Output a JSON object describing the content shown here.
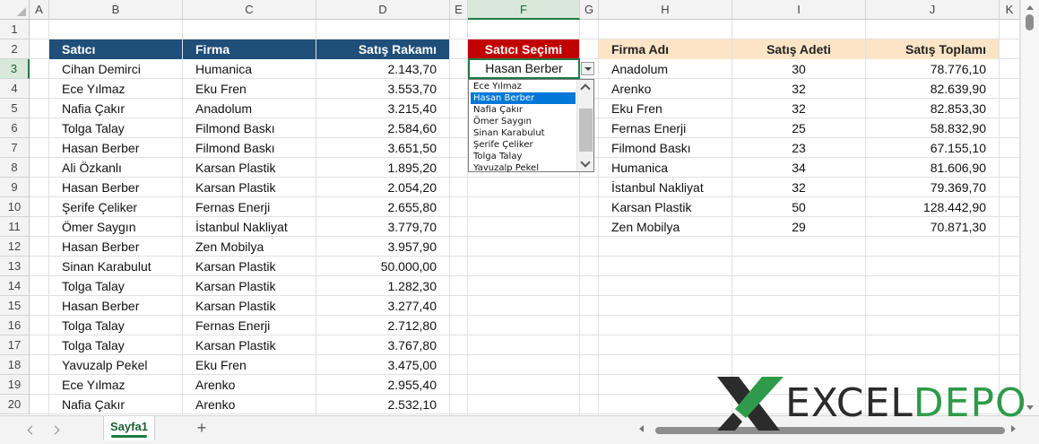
{
  "columns": [
    "A",
    "B",
    "C",
    "D",
    "E",
    "F",
    "G",
    "H",
    "I",
    "J",
    "K"
  ],
  "selected_column": "F",
  "rows": [
    "1",
    "2",
    "3",
    "4",
    "5",
    "6",
    "7",
    "8",
    "9",
    "10",
    "11",
    "12",
    "13",
    "14",
    "15",
    "16",
    "17",
    "18",
    "19",
    "20"
  ],
  "selected_row": "3",
  "sales_table": {
    "headers": [
      "Satıcı",
      "Firma",
      "Satış Rakamı"
    ],
    "rows": [
      [
        "Cihan Demirci",
        "Humanica",
        "2.143,70"
      ],
      [
        "Ece Yılmaz",
        "Eku Fren",
        "3.553,70"
      ],
      [
        "Nafia Çakır",
        "Anadolum",
        "3.215,40"
      ],
      [
        "Tolga Talay",
        "Filmond Baskı",
        "2.584,60"
      ],
      [
        "Hasan Berber",
        "Filmond Baskı",
        "3.651,50"
      ],
      [
        "Ali Özkanlı",
        "Karsan Plastik",
        "1.895,20"
      ],
      [
        "Hasan Berber",
        "Karsan Plastik",
        "2.054,20"
      ],
      [
        "Şerife Çeliker",
        "Fernas Enerji",
        "2.655,80"
      ],
      [
        "Ömer Saygın",
        "İstanbul Nakliyat",
        "3.779,70"
      ],
      [
        "Hasan Berber",
        "Zen Mobilya",
        "3.957,90"
      ],
      [
        "Sinan Karabulut",
        "Karsan Plastik",
        "50.000,00"
      ],
      [
        "Tolga Talay",
        "Karsan Plastik",
        "1.282,30"
      ],
      [
        "Hasan Berber",
        "Karsan Plastik",
        "3.277,40"
      ],
      [
        "Tolga Talay",
        "Fernas Enerji",
        "2.712,80"
      ],
      [
        "Tolga Talay",
        "Karsan Plastik",
        "3.767,80"
      ],
      [
        "Yavuzalp Pekel",
        "Eku Fren",
        "3.475,00"
      ],
      [
        "Ece Yılmaz",
        "Arenko",
        "2.955,40"
      ],
      [
        "Nafia Çakır",
        "Arenko",
        "2.532,10"
      ]
    ]
  },
  "selector": {
    "header": "Satıcı Seçimi",
    "value": "Hasan Berber",
    "dropdown_items": [
      "Ece Yılmaz",
      "Hasan Berber",
      "Nafia Çakır",
      "Ömer Saygın",
      "Sinan Karabulut",
      "Şerife Çeliker",
      "Tolga Talay",
      "Yavuzalp Pekel"
    ],
    "active_item": "Hasan Berber"
  },
  "summary_table": {
    "headers": [
      "Firma Adı",
      "Satış Adeti",
      "Satış Toplamı"
    ],
    "rows": [
      [
        "Anadolum",
        "30",
        "78.776,10"
      ],
      [
        "Arenko",
        "32",
        "82.639,90"
      ],
      [
        "Eku Fren",
        "32",
        "82.853,30"
      ],
      [
        "Fernas Enerji",
        "25",
        "58.832,90"
      ],
      [
        "Filmond Baskı",
        "23",
        "67.155,10"
      ],
      [
        "Humanica",
        "34",
        "81.606,90"
      ],
      [
        "İstanbul Nakliyat",
        "32",
        "79.369,70"
      ],
      [
        "Karsan Plastik",
        "50",
        "128.442,90"
      ],
      [
        "Zen Mobilya",
        "29",
        "70.871,30"
      ]
    ]
  },
  "sheet_tabs": [
    "Sayfa1"
  ],
  "add_sheet_label": "+",
  "logo": {
    "part1": "EXCEL",
    "part2": "DEPO"
  },
  "colors": {
    "header_blue": "#1f4e79",
    "header_red": "#c00000",
    "header_peach": "#fce4c6",
    "accent_green": "#1f7a45"
  }
}
